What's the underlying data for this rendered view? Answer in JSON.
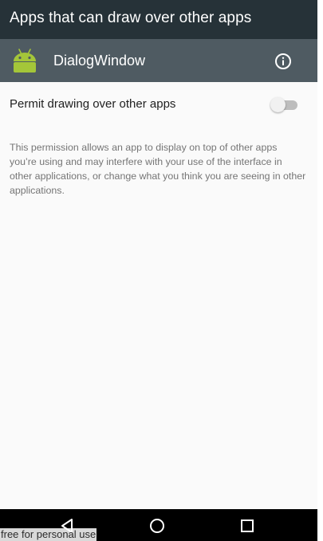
{
  "titlebar": {
    "title": "Apps that can draw over other apps"
  },
  "app_header": {
    "app_name": "DialogWindow",
    "app_icon": "android-robot-icon",
    "info_icon": "info-icon"
  },
  "setting": {
    "label": "Permit drawing over other apps",
    "toggle_state": "off"
  },
  "description": "This permission allows an app to display on top of other apps you’re using and may interfere with your use of the interface in other applications, or change what you think you are seeing in other applications.",
  "navbar": {
    "back_icon": "back-triangle-icon",
    "home_icon": "home-circle-icon",
    "recents_icon": "recents-square-icon"
  },
  "watermark": "free for personal use",
  "colors": {
    "titlebar": "#263238",
    "app_header": "#4f5b62",
    "background": "#fafafa",
    "android_green": "#a4c639",
    "navbar": "#000000"
  }
}
